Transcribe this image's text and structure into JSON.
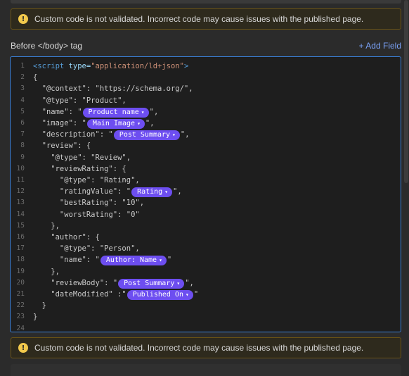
{
  "warning_text": "Custom code is not validated. Incorrect code may cause issues with the published page.",
  "section": {
    "label": "Before </body> tag",
    "add_field": "+ Add Field"
  },
  "editor": {
    "lines": [
      "1",
      "2",
      "3",
      "4",
      "5",
      "6",
      "7",
      "8",
      "9",
      "10",
      "11",
      "12",
      "13",
      "14",
      "15",
      "16",
      "17",
      "18",
      "19",
      "20",
      "21",
      "22",
      "23",
      "24"
    ],
    "code": {
      "l1_open": "<script",
      "l1_attr": " type=",
      "l1_val": "\"application/ld+json\"",
      "l1_close": ">",
      "l2": "{",
      "l3": "  \"@context\": \"https://schema.org/\",",
      "l4": "  \"@type\": \"Product\",",
      "l5_pre": "  \"name\": \"",
      "l5_post": "\",",
      "l6_pre": "  \"image\": \"",
      "l6_post": "\",",
      "l7_pre": "  \"description\": \"",
      "l7_post": "\",",
      "l8": "  \"review\": {",
      "l9": "    \"@type\": \"Review\",",
      "l10": "    \"reviewRating\": {",
      "l11": "      \"@type\": \"Rating\",",
      "l12_pre": "      \"ratingValue\": \"",
      "l12_post": "\",",
      "l13": "      \"bestRating\": \"10\",",
      "l14": "      \"worstRating\": \"0\"",
      "l15": "    },",
      "l16": "    \"author\": {",
      "l17": "      \"@type\": \"Person\",",
      "l18_pre": "      \"name\": \"",
      "l18_post": "\"",
      "l19": "    },",
      "l20_pre": "    \"reviewBody\": \"",
      "l20_post": "\",",
      "l21_pre": "    \"dateModified\" :\"",
      "l21_post": "\"",
      "l22": "  }",
      "l23": "}",
      "l24": ""
    },
    "tokens": {
      "product_name": "Product name",
      "main_image": "Main Image",
      "post_summary": "Post Summary",
      "rating": "Rating",
      "author_name": "Author: Name",
      "post_summary_2": "Post Summary",
      "published_on": "Published On"
    }
  },
  "colors": {
    "accent": "#6d4ef0",
    "link": "#7aa2f7",
    "focus_border": "#3a80d8",
    "warning": "#f2c94c"
  }
}
